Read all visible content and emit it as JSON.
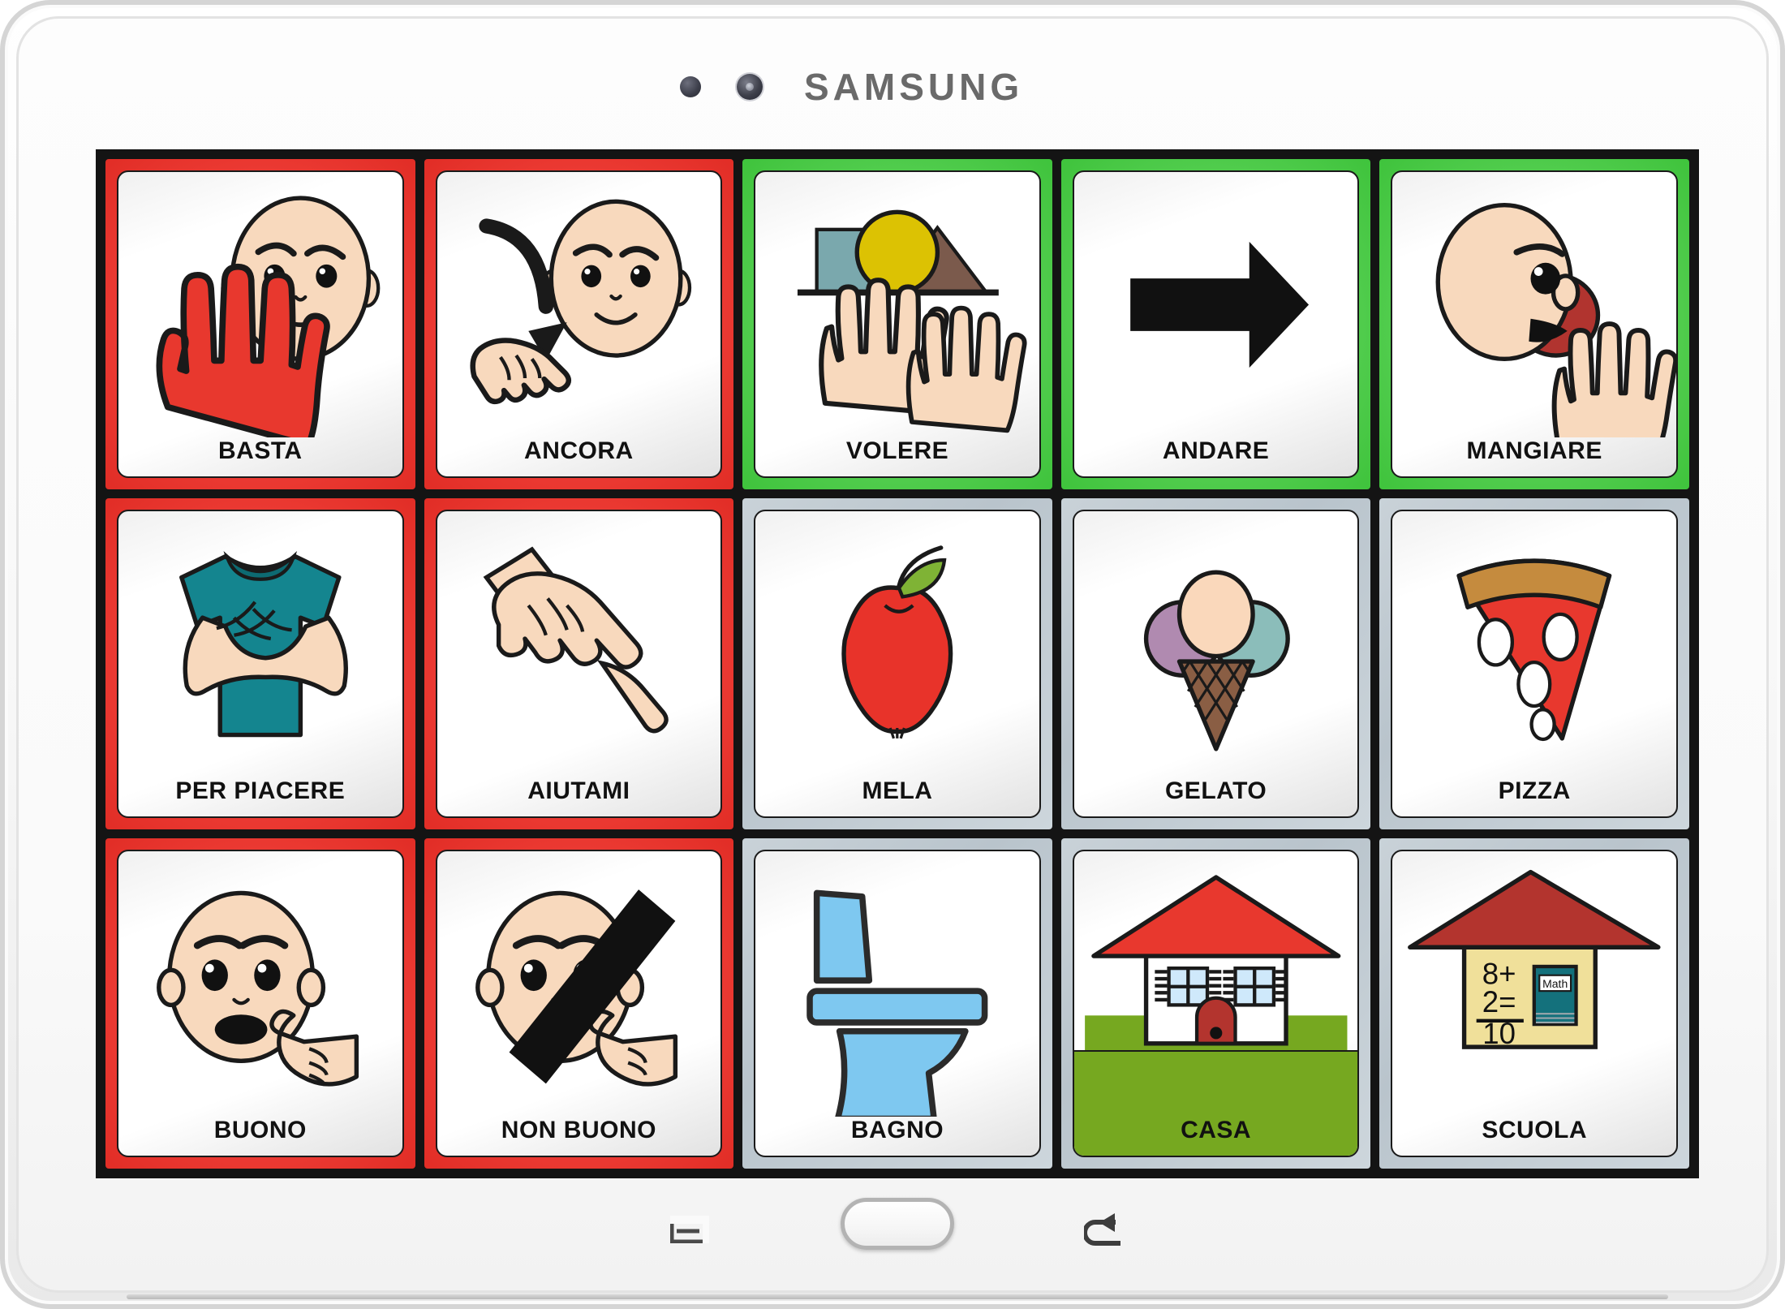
{
  "device": {
    "brand": "SAMSUNG",
    "sensor_icon": "proximity-sensor",
    "camera_icon": "front-camera"
  },
  "nav": {
    "menu_label": "menu-icon",
    "home_label": "home-button",
    "back_label": "back-icon"
  },
  "board": {
    "columns": 5,
    "rows": 3,
    "colors": {
      "red": "#ee3d36",
      "green": "#56cf52",
      "gray": "#bfc9d1",
      "black_frame": "#141414"
    },
    "cells": [
      {
        "label": "BASTA",
        "frame": "red",
        "icon": "stop-hand-face"
      },
      {
        "label": "ANCORA",
        "frame": "red",
        "icon": "arrow-down-fist-face"
      },
      {
        "label": "VOLERE",
        "frame": "green",
        "icon": "two-hands-shapes"
      },
      {
        "label": "ANDARE",
        "frame": "green",
        "icon": "right-arrow"
      },
      {
        "label": "MANGIARE",
        "frame": "green",
        "icon": "face-eating-apple"
      },
      {
        "label": "PER PIACERE",
        "frame": "red",
        "icon": "crossed-arms-tshirt"
      },
      {
        "label": "AIUTAMI",
        "frame": "red",
        "icon": "helping-hands"
      },
      {
        "label": "MELA",
        "frame": "gray",
        "icon": "apple"
      },
      {
        "label": "GELATO",
        "frame": "gray",
        "icon": "ice-cream-cone"
      },
      {
        "label": "PIZZA",
        "frame": "gray",
        "icon": "pizza-slice"
      },
      {
        "label": "BUONO",
        "frame": "red",
        "icon": "face-smiling-finger-cheek"
      },
      {
        "label": "NON BUONO",
        "frame": "red",
        "icon": "face-finger-cheek-crossed"
      },
      {
        "label": "BAGNO",
        "frame": "gray",
        "icon": "toilet"
      },
      {
        "label": "CASA",
        "frame": "gray",
        "icon": "house",
        "has_grass": true
      },
      {
        "label": "SCUOLA",
        "frame": "gray",
        "icon": "school-house"
      }
    ]
  },
  "school_icon_text": {
    "line1": "8+",
    "line2": "2=",
    "line3": "10",
    "book": "Math"
  }
}
